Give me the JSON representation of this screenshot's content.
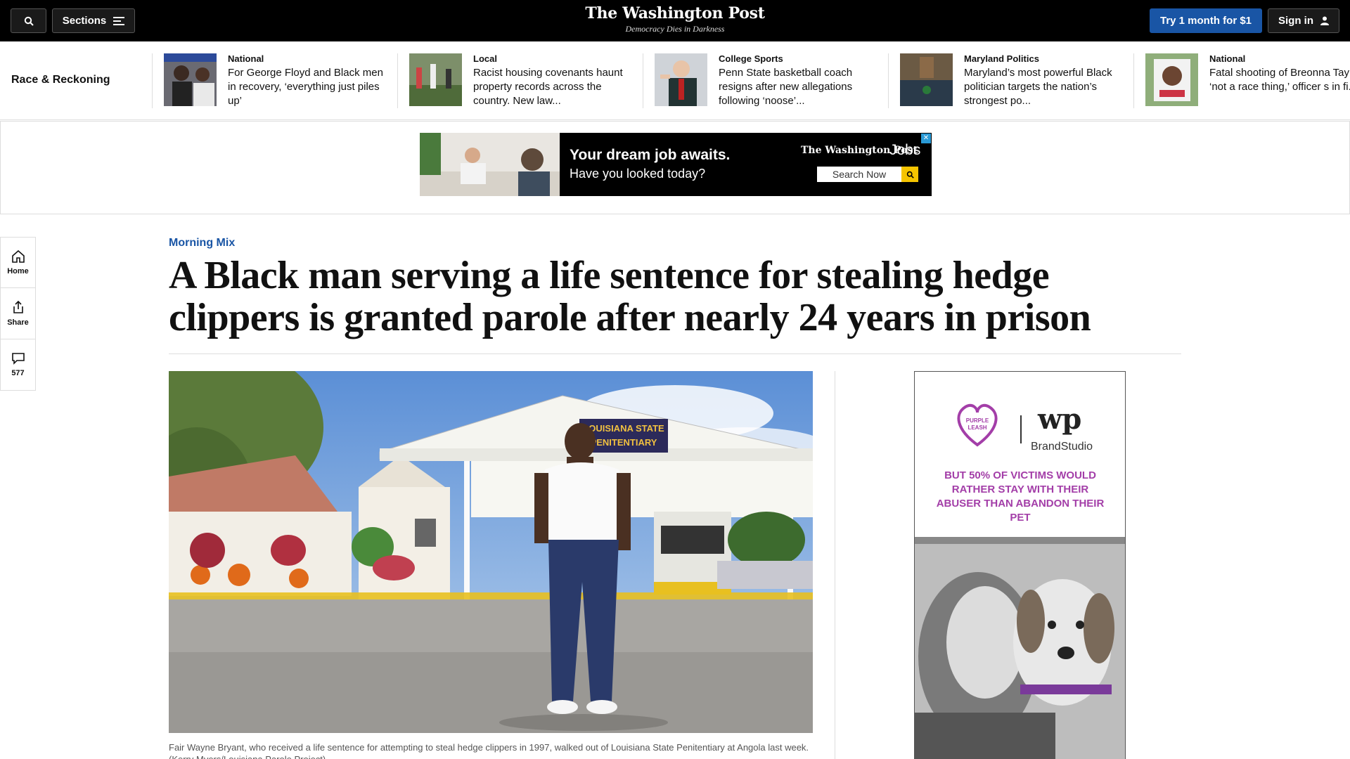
{
  "topbar": {
    "sections_label": "Sections",
    "logo": "The Washington Post",
    "tagline": "Democracy Dies in Darkness",
    "try_label": "Try 1 month for $1",
    "signin_label": "Sign in"
  },
  "strip": {
    "label": "Race & Reckoning",
    "items": [
      {
        "kicker": "National",
        "headline": "For George Floyd and Black men in recovery, ‘everything just piles up’"
      },
      {
        "kicker": "Local",
        "headline": "Racist housing covenants haunt property records across the country. New law..."
      },
      {
        "kicker": "College Sports",
        "headline": "Penn State basketball coach resigns after new allegations following ‘noose’..."
      },
      {
        "kicker": "Maryland Politics",
        "headline": "Maryland’s most powerful Black politician targets the nation’s strongest po..."
      },
      {
        "kicker": "National",
        "headline": "Fatal shooting of Breonna Tay was ‘not a race thing,’ officer s in fi..."
      }
    ]
  },
  "ad_banner": {
    "headline": "Your dream job awaits.",
    "subline": "Have you looked today?",
    "logo": "The Washington Post",
    "jobs": "Jobs",
    "search_label": "Search Now"
  },
  "rail": {
    "home": "Home",
    "share": "Share",
    "comments": "577"
  },
  "article": {
    "kicker": "Morning Mix",
    "headline": "A Black man serving a life sentence for stealing hedge clippers is granted parole after nearly 24 years in prison",
    "sign_text": "LOUISIANA STATE PENITENTIARY",
    "caption": "Fair Wayne Bryant, who received a life sentence for attempting to steal hedge clippers in 1997, walked out of Louisiana State Penitentiary at Angola last week. (Kerry Myers/Louisiana Parole Project)"
  },
  "side_ad": {
    "badge": "PURPLE LEASH PROJECT",
    "wp_mark": "wp",
    "studio": "BrandStudio",
    "text": "BUT 50% OF VICTIMS WOULD RATHER STAY WITH THEIR ABUSER THAN ABANDON THEIR PET"
  },
  "colors": {
    "accent": "#1955a5",
    "topbar_bg": "#000000",
    "ad_text": "#a33ea8"
  }
}
